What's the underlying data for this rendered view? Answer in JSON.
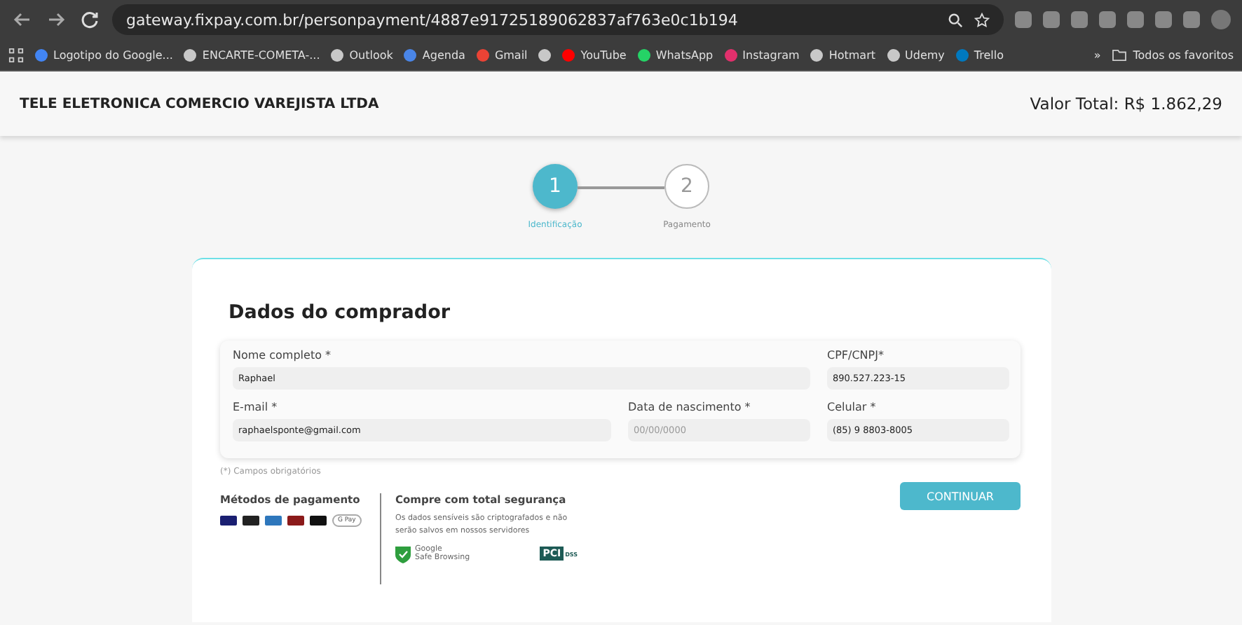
{
  "browser": {
    "url": "gateway.fixpay.com.br/personpayment/4887e91725189062837af763e0c1b194",
    "bookmarks": [
      {
        "label": "Logotipo do Google...",
        "color": "#4285f4"
      },
      {
        "label": "ENCARTE-COMETA-...",
        "color": "#c8c8c8"
      },
      {
        "label": "Outlook",
        "color": "#c8c8c8"
      },
      {
        "label": "Agenda",
        "color": "#4a86e8"
      },
      {
        "label": "Gmail",
        "color": "#ea4335"
      },
      {
        "color": "#c8c8c8"
      },
      {
        "label": "YouTube",
        "color": "#ff0000"
      },
      {
        "label": "WhatsApp",
        "color": "#25d366"
      },
      {
        "label": "Instagram",
        "color": "#e1306c"
      },
      {
        "label": "Hotmart",
        "color": "#c8c8c8"
      },
      {
        "label": "Udemy",
        "color": "#c8c8c8"
      },
      {
        "label": "Trello",
        "color": "#0079bf"
      }
    ],
    "more": "»",
    "folder": "Todos os favoritos"
  },
  "header": {
    "company": "TELE ELETRONICA COMERCIO VAREJISTA LTDA",
    "total": "Valor Total: R$ 1.862,29"
  },
  "steps": [
    {
      "number": "1",
      "label": "Identificação",
      "selected": true
    },
    {
      "number": "2",
      "label": "Pagamento",
      "selected": false
    }
  ],
  "form": {
    "title": "Dados do comprador",
    "fields": [
      {
        "label": "Nome completo *",
        "value": "Raphael"
      },
      {
        "label": "CPF/CNPJ*",
        "value": "890.527.223-15"
      },
      {
        "label": "E-mail *",
        "value": "raphaelsponte@gmail.com"
      },
      {
        "label": "Data de nascimento *",
        "placeholder": "00/00/0000"
      },
      {
        "label": "Celular *",
        "value": "(85) 9 8803-8005"
      }
    ],
    "note": "(*) Campos obrigatórios"
  },
  "payment": {
    "title": "Métodos de pagamento",
    "cards": [
      {
        "color": "#1a1f71"
      },
      {
        "color": "#222222"
      },
      {
        "color": "#2e77bc"
      },
      {
        "color": "#8b1a1a"
      },
      {
        "color": "#111111"
      }
    ],
    "gpay": "G Pay"
  },
  "security": {
    "title": "Compre com total segurança",
    "text": "Os dados sensíveis são criptografados e não serão salvos em nossos servidores",
    "google": "Google",
    "safe": "Safe Browsing",
    "pci": "PCI",
    "dss": "DSS"
  },
  "button": "CONTINUAR"
}
